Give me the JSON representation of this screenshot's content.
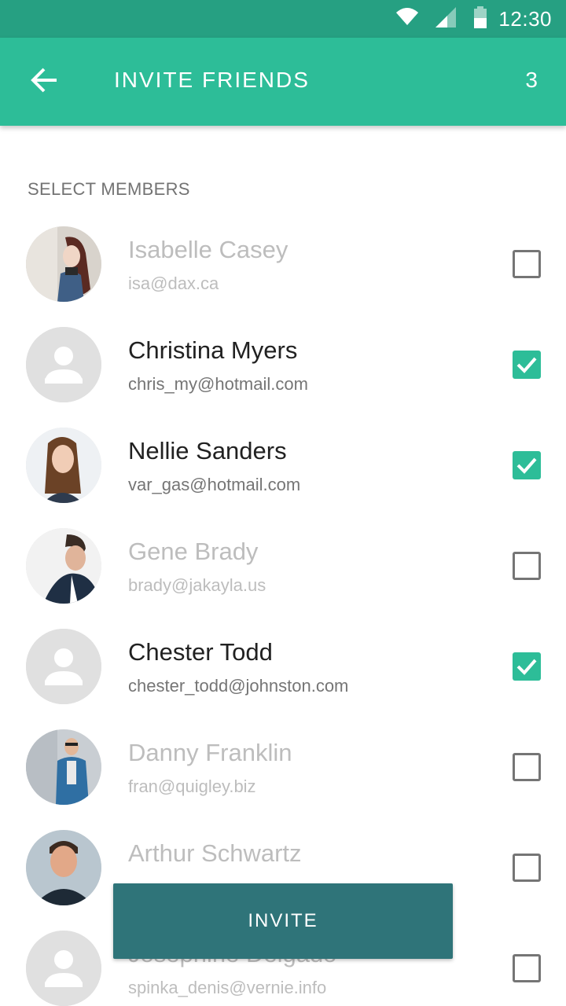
{
  "status_bar": {
    "time": "12:30"
  },
  "app_bar": {
    "title": "INVITE FRIENDS",
    "count": "3"
  },
  "section_header": "SELECT MEMBERS",
  "members": [
    {
      "name": "Isabelle Casey",
      "email": "isa@dax.ca",
      "checked": false,
      "avatar": "photo"
    },
    {
      "name": "Christina Myers",
      "email": "chris_my@hotmail.com",
      "checked": true,
      "avatar": "placeholder"
    },
    {
      "name": "Nellie Sanders",
      "email": "var_gas@hotmail.com",
      "checked": true,
      "avatar": "photo"
    },
    {
      "name": "Gene Brady",
      "email": "brady@jakayla.us",
      "checked": false,
      "avatar": "photo"
    },
    {
      "name": "Chester Todd",
      "email": "chester_todd@johnston.com",
      "checked": true,
      "avatar": "placeholder"
    },
    {
      "name": "Danny Franklin",
      "email": "fran@quigley.biz",
      "checked": false,
      "avatar": "photo"
    },
    {
      "name": "Arthur Schwartz",
      "email": "",
      "checked": false,
      "avatar": "photo"
    },
    {
      "name": "Josephine Delgado",
      "email": "spinka_denis@vernie.info",
      "checked": false,
      "avatar": "placeholder"
    }
  ],
  "invite_button": "INVITE",
  "colors": {
    "status_bar": "#26a082",
    "app_bar": "#2dbd98",
    "checkbox_checked": "#2dbd98",
    "invite_button": "#2f7479"
  }
}
